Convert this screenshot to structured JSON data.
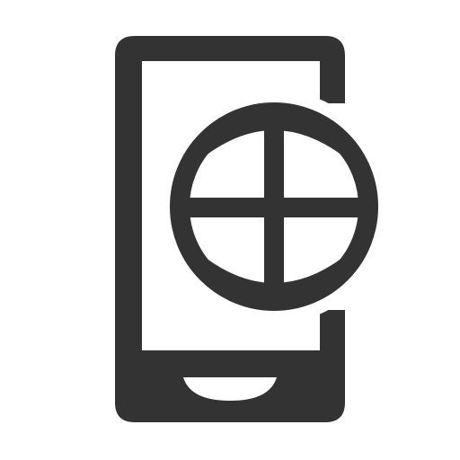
{
  "icon": {
    "name": "mobile-web-icon",
    "parts": [
      "smartphone-icon",
      "globe-icon"
    ],
    "color": "#333333",
    "background": "#ffffff"
  }
}
